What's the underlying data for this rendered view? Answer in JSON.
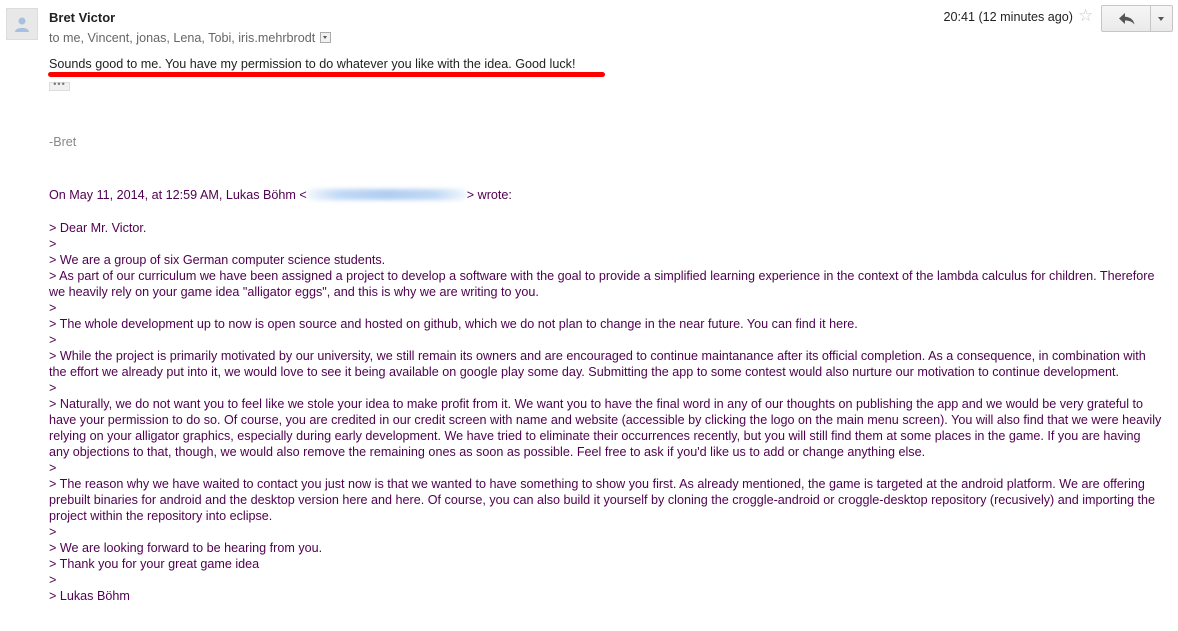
{
  "email": {
    "sender": "Bret Victor",
    "recipients": "to me, Vincent, jonas, Lena, Tobi, iris.mehrbrodt",
    "timestamp": "20:41 (12 minutes ago)",
    "body": "Sounds good to me.  You have my permission to do whatever you like with the idea.  Good luck!",
    "ellipsis": "•••",
    "signature": "-Bret",
    "quote_header_prefix": "On May 11, 2014, at 12:59 AM, Lukas Böhm <",
    "quote_header_suffix": "> wrote:",
    "quoted_lines": [
      "> Dear Mr. Victor.",
      ">",
      "> We are a group of six German computer science students.",
      "> As part of our curriculum we have been assigned a project to develop a software with the goal to provide a simplified learning experience in the context of the lambda calculus for children. Therefore we heavily rely on your game idea \"alligator eggs\", and this is why we are writing to you.",
      ">",
      "> The whole development up to now is open source and hosted on github, which we do not plan to change in the near future. You can find it here.",
      ">",
      "> While the project is primarily motivated by our university, we still remain its owners and are encouraged to continue maintanance after its official completion. As a consequence, in combination with the effort we already put into it, we would love to see it being available on google play some day. Submitting the app to some contest would also nurture our motivation to continue development.",
      ">",
      "> Naturally, we do not want you to feel like we stole your idea to make profit from it. We want you to have the final word in any of our thoughts on publishing the app and we would be very grateful to have your permission to do so. Of course, you are credited in our credit screen with name and website (accessible by clicking the logo on the main menu screen). You will also find that we were heavily relying on your alligator graphics, especially during early development. We have tried to eliminate their occurrences recently, but you will still find them at some places in the game. If you are having any objections to that, though, we would also remove the remaining ones as soon as possible. Feel free to ask if you'd like us to add or change anything else.",
      ">",
      "> The reason why we have waited to contact you just now is that we wanted to have something to show you first. As already mentioned, the game is targeted at the android platform. We are offering prebuilt binaries for android and the desktop version here and here. Of course, you can also build it yourself by cloning the croggle-android or croggle-desktop repository (recusively) and importing the project within the repository into eclipse.",
      ">",
      "> We are looking forward to be hearing from you.",
      "> Thank you for your great game idea",
      ">",
      "> Lukas Böhm"
    ]
  },
  "icons": {
    "avatar": "person-silhouette-icon",
    "star": "star-outline-icon",
    "reply": "reply-arrow-icon",
    "more": "chevron-down-icon",
    "details": "details-toggle-icon"
  },
  "colors": {
    "quoted_text": "#500050",
    "highlight_mark": "#ff0000",
    "signature": "#888888"
  }
}
